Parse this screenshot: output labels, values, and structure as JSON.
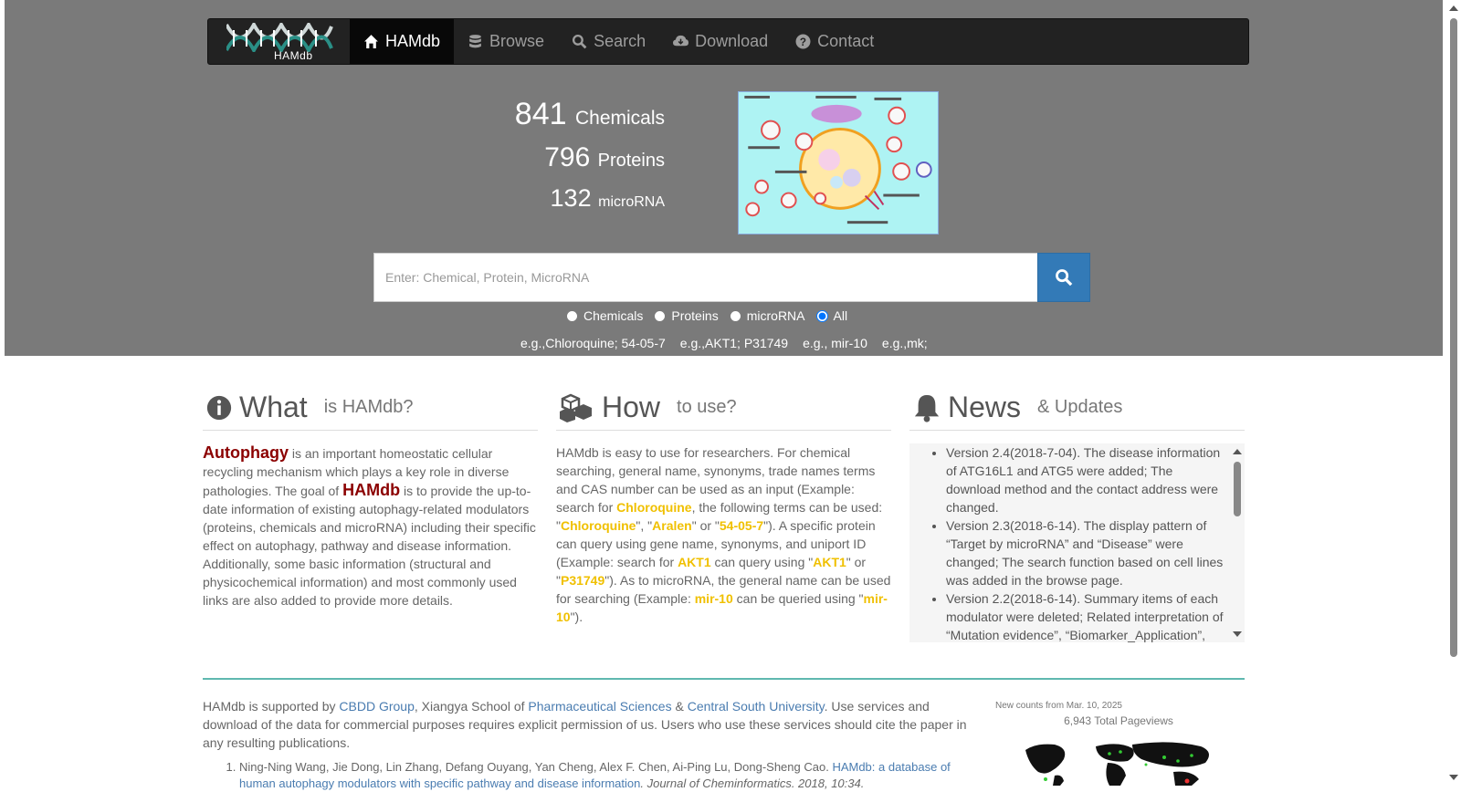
{
  "nav": {
    "logo_text": "HAMdb",
    "items": [
      {
        "label": "HAMdb",
        "icon": "home-icon"
      },
      {
        "label": "Browse",
        "icon": "database-icon"
      },
      {
        "label": "Search",
        "icon": "search-icon"
      },
      {
        "label": "Download",
        "icon": "cloud-download-icon"
      },
      {
        "label": "Contact",
        "icon": "question-circle-icon"
      }
    ]
  },
  "stats": [
    {
      "count": "841",
      "label": "Chemicals"
    },
    {
      "count": "796",
      "label": "Proteins"
    },
    {
      "count": "132",
      "label": "microRNA"
    }
  ],
  "search": {
    "placeholder": "Enter: Chemical, Protein, MicroRNA",
    "value": "",
    "options": [
      {
        "label": "Chemicals",
        "checked": false
      },
      {
        "label": "Proteins",
        "checked": false
      },
      {
        "label": "microRNA",
        "checked": false
      },
      {
        "label": "All",
        "checked": true
      }
    ],
    "examples": [
      "e.g.,Chloroquine; 54-05-7",
      "e.g.,AKT1; P31749",
      "e.g., mir-10",
      "e.g.,mk;"
    ]
  },
  "what": {
    "title": "What",
    "subtitle": "is HAMdb?",
    "term1": "Autophagy",
    "text1": " is an important homeostatic cellular recycling mechanism which plays a key role in diverse pathologies. The goal of ",
    "term2": "HAMdb",
    "text2": " is to provide the up-to-date information of existing autophagy-related modulators (proteins, chemicals and microRNA) including their specific effect on autophagy, pathway and disease information. Additionally, some basic information (structural and physicochemical information) and most commonly used links are also added to provide more details."
  },
  "how": {
    "title": "How",
    "subtitle": "to use?",
    "p1": "HAMdb is easy to use for researchers. For chemical searching, general name, synonyms, trade names terms and CAS number can be used as an input (Example: search for ",
    "k1": "Chloroquine",
    "p2": ", the following terms can be used: \"",
    "k2": "Chloroquine",
    "p3": "\", \"",
    "k3": "Aralen",
    "p4": "\" or \"",
    "k4": "54-05-7",
    "p5": "\"). A specific protein can query using gene name, synonyms, and uniport ID (Example: search for ",
    "k5": "AKT1",
    "p6": " can query using \"",
    "k6": "AKT1",
    "p7": "\" or \"",
    "k7": "P31749",
    "p8": "\"). As to microRNA, the general name can be used for searching (Example: ",
    "k8": "mir-10",
    "p9": " can be queried using \"",
    "k9": "mir-10",
    "p10": "\")."
  },
  "news": {
    "title": "News",
    "subtitle": "& Updates",
    "items": [
      "Version 2.4(2018-7-04). The disease information of ATG16L1 and ATG5 were added; The download method and the contact address were changed.",
      "Version 2.3(2018-6-14). The display pattern of “Target by microRNA” and “Disease” were changed; The search function based on cell lines was added in the browse page.",
      "Version 2.2(2018-6-14). Summary items of each modulator were deleted; Related interpretation of “Mutation evidence”, “Biomarker_Application”,"
    ]
  },
  "footer": {
    "t1": "HAMdb is supported by ",
    "l1": "CBDD Group",
    "t2": ", Xiangya School of ",
    "l2": "Pharmaceutical Sciences",
    "t3": " & ",
    "l3": "Central South University",
    "t4": ". Use services and download of the data for commercial purposes requires explicit permission of us. Users who use these services should cite the paper in any resulting publications.",
    "ref_authors": "Ning-Ning Wang, Jie Dong, Lin Zhang, Defang Ouyang, Yan Cheng, Alex F. Chen, Ai-Ping Lu, Dong-Sheng Cao. ",
    "ref_title": "HAMdb: a database of human autophagy modulators with specific pathway and disease information",
    "ref_journal": ". Journal of Cheminformatics. 2018, 10:34."
  },
  "counter": {
    "since": "New counts from Mar. 10, 2025",
    "pageviews": "6,943 Total Pageviews"
  },
  "colors": {
    "hero_bg": "#7a7a7a",
    "navbar_bg": "#222222",
    "search_btn": "#337ab7",
    "highlight_red": "#8b0000",
    "highlight_gold": "#f0c000",
    "divider": "#5fb8b0",
    "link": "#4a7cb0"
  }
}
